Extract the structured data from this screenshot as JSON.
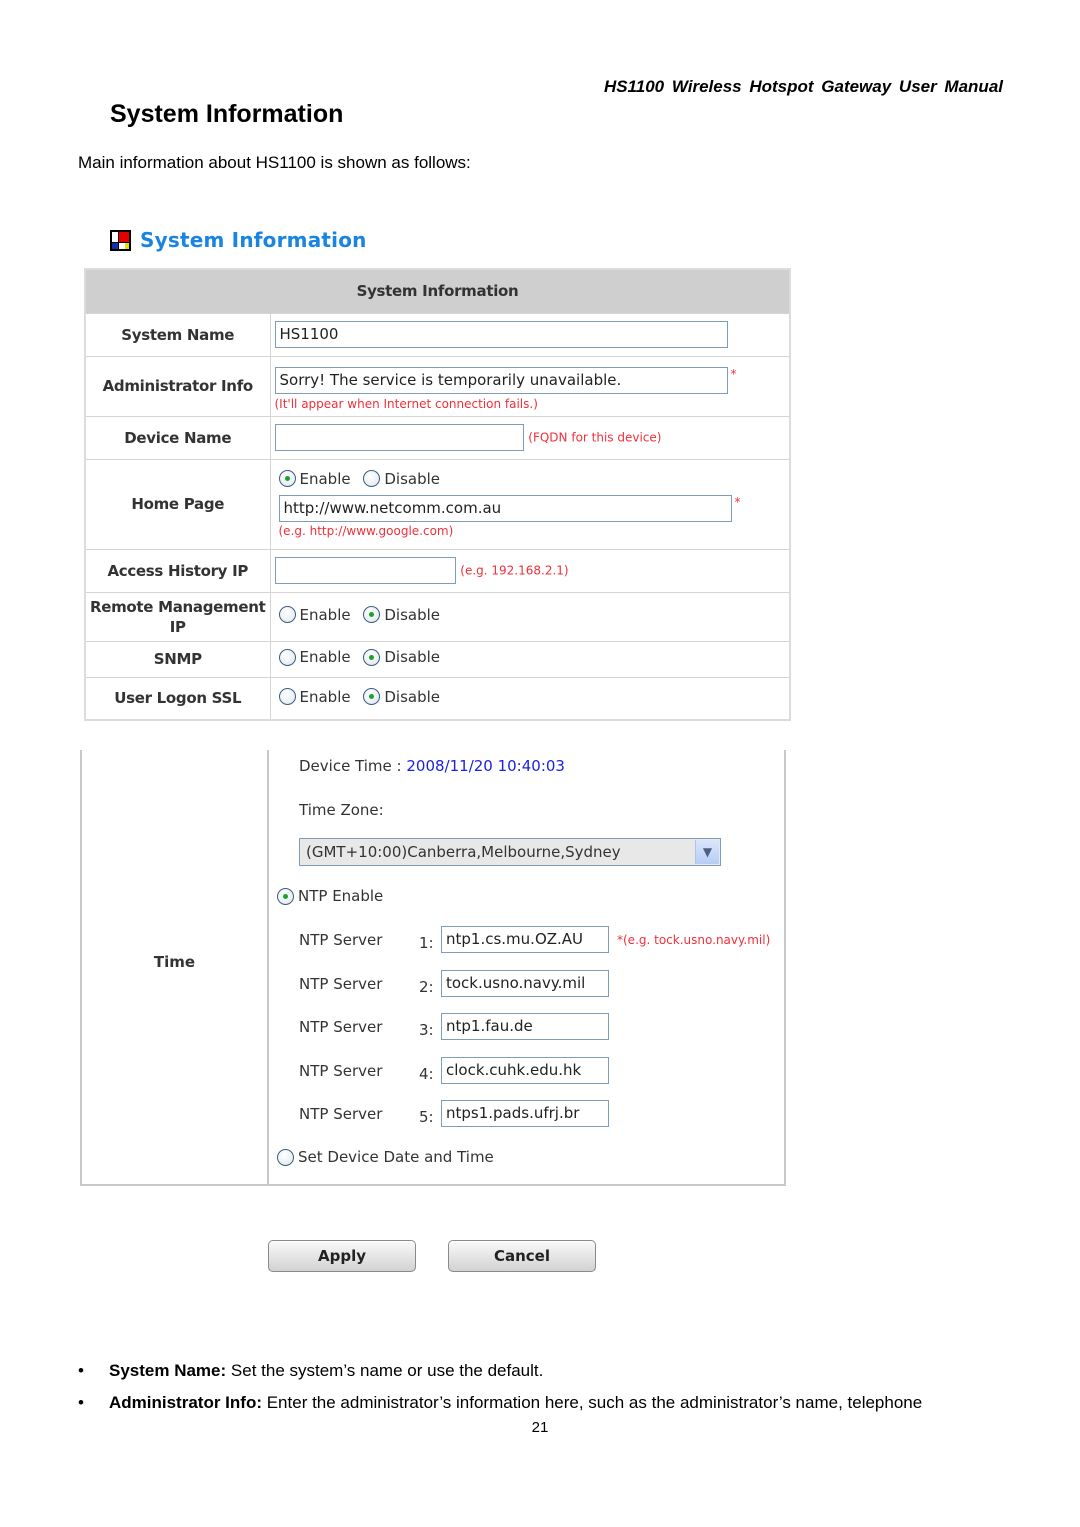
{
  "document": {
    "running_header": "HS1100 Wireless Hotspot Gateway User Manual",
    "section_title": "System Information",
    "intro": "Main information about HS1100 is shown as follows:",
    "page_number": "21"
  },
  "ui": {
    "title": "System Information",
    "title_icon": "mondrian-logo-icon",
    "colors": {
      "title_blue": "#1a85e0",
      "hint_red": "#f0303a",
      "time_blue": "#1a22e0",
      "header_gray": "#cfcfcf"
    },
    "table_header": "System Information",
    "radio_enable": "Enable",
    "radio_disable": "Disable",
    "rows": {
      "system_name": {
        "label": "System Name",
        "value": "HS1100"
      },
      "admin_info": {
        "label": "Administrator Info",
        "value": "Sorry! The service is temporarily unavailable.",
        "required": "*",
        "hint": "(It'll appear when Internet connection fails.)"
      },
      "device_name": {
        "label": "Device Name",
        "value": "",
        "hint": "(FQDN for this device)"
      },
      "home_page": {
        "label": "Home Page",
        "selected": "Enable",
        "value": "http://www.netcomm.com.au",
        "required": "*",
        "hint": "(e.g. http://www.google.com)"
      },
      "access_history_ip": {
        "label": "Access History IP",
        "value": "",
        "hint": "(e.g. 192.168.2.1)"
      },
      "remote_mgmt_ip": {
        "label_line1": "Remote Management",
        "label_line2": "IP",
        "selected": "Disable"
      },
      "snmp": {
        "label": "SNMP",
        "selected": "Disable"
      },
      "user_logon_ssl": {
        "label": "User Logon SSL",
        "selected": "Disable"
      }
    },
    "time": {
      "label": "Time",
      "device_time_label": "Device Time : ",
      "device_time_value": "2008/11/20 10:40:03",
      "time_zone_label": "Time Zone:",
      "time_zone_selected": "(GMT+10:00)Canberra,Melbourne,Sydney",
      "ntp_enable_label": "NTP Enable",
      "ntp_enable_selected": true,
      "ntp_server_label": "NTP Server",
      "ntp_hint": "*(e.g. tock.usno.navy.mil)",
      "ntp_servers": [
        {
          "num": "1:",
          "value": "ntp1.cs.mu.OZ.AU"
        },
        {
          "num": "2:",
          "value": "tock.usno.navy.mil"
        },
        {
          "num": "3:",
          "value": "ntp1.fau.de"
        },
        {
          "num": "4:",
          "value": "clock.cuhk.edu.hk"
        },
        {
          "num": "5:",
          "value": "ntps1.pads.ufrj.br"
        }
      ],
      "set_device_label": "Set Device Date and Time",
      "set_device_selected": false
    },
    "buttons": {
      "apply": "Apply",
      "cancel": "Cancel"
    }
  },
  "bullets": [
    {
      "term": "System Name:",
      "text": " Set the system’s name or use the default."
    },
    {
      "term": "Administrator Info:",
      "text": " Enter the administrator’s information here, such as the administrator’s name, telephone"
    }
  ]
}
